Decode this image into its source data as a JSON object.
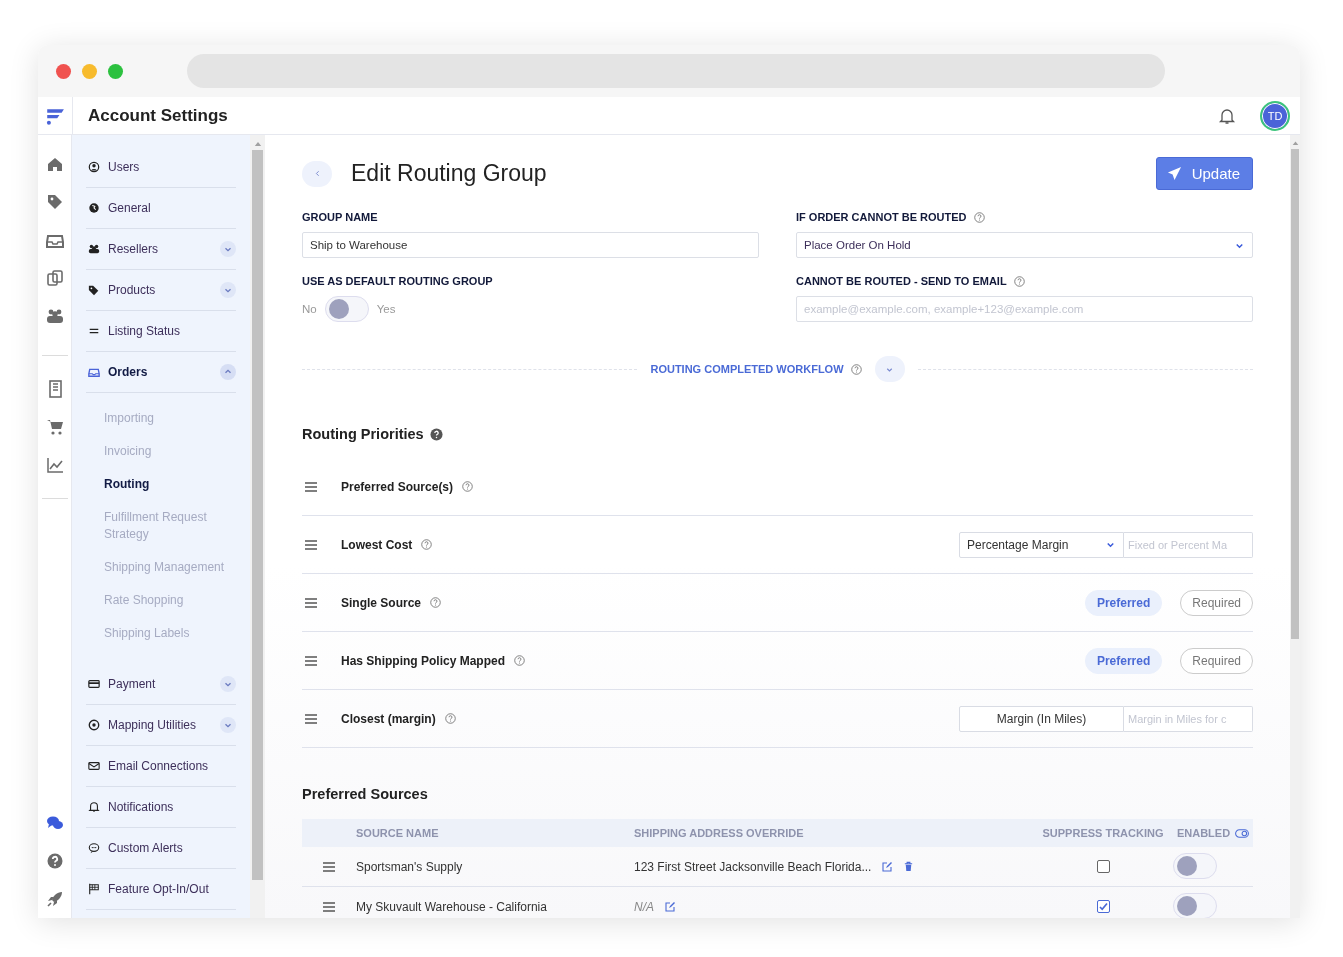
{
  "app": {
    "title": "Account Settings",
    "avatar": "TD"
  },
  "sidebar": {
    "items": [
      {
        "label": "Users",
        "expandable": false,
        "selected": false
      },
      {
        "label": "General",
        "expandable": false,
        "selected": false
      },
      {
        "label": "Resellers",
        "expandable": true,
        "expanded": false,
        "selected": false
      },
      {
        "label": "Products",
        "expandable": true,
        "expanded": false,
        "selected": false
      },
      {
        "label": "Listing Status",
        "expandable": false,
        "selected": false
      },
      {
        "label": "Orders",
        "expandable": true,
        "expanded": true,
        "selected": true,
        "children": [
          {
            "label": "Importing",
            "selected": false
          },
          {
            "label": "Invoicing",
            "selected": false
          },
          {
            "label": "Routing",
            "selected": true
          },
          {
            "label": "Fulfillment Request Strategy",
            "selected": false
          },
          {
            "label": "Shipping Management",
            "selected": false
          },
          {
            "label": "Rate Shopping",
            "selected": false
          },
          {
            "label": "Shipping Labels",
            "selected": false
          }
        ]
      },
      {
        "label": "Payment",
        "expandable": true,
        "expanded": false,
        "selected": false
      },
      {
        "label": "Mapping Utilities",
        "expandable": true,
        "expanded": false,
        "selected": false
      },
      {
        "label": "Email Connections",
        "expandable": false,
        "selected": false
      },
      {
        "label": "Notifications",
        "expandable": false,
        "selected": false
      },
      {
        "label": "Custom Alerts",
        "expandable": false,
        "selected": false
      },
      {
        "label": "Feature Opt-In/Out",
        "expandable": false,
        "selected": false
      }
    ]
  },
  "page": {
    "title": "Edit Routing Group",
    "update_button": "Update",
    "group_name": {
      "label": "GROUP NAME",
      "value": "Ship to Warehouse"
    },
    "cannot_route": {
      "label": "IF ORDER CANNOT BE ROUTED",
      "value": "Place Order On Hold"
    },
    "default_group": {
      "label": "USE AS DEFAULT ROUTING GROUP",
      "off_label": "No",
      "on_label": "Yes",
      "on": false
    },
    "send_email": {
      "label": "CANNOT BE ROUTED - SEND TO EMAIL",
      "placeholder": "example@example.com, example+123@example.com"
    },
    "workflow": {
      "label": "ROUTING COMPLETED WORKFLOW",
      "expanded": false
    }
  },
  "routing_priorities": {
    "title": "Routing Priorities",
    "rows": [
      {
        "kind": "plain",
        "label": "Preferred Source(s)"
      },
      {
        "kind": "select-input",
        "label": "Lowest Cost",
        "select": "Percentage Margin",
        "placeholder": "Fixed or Percent Ma"
      },
      {
        "kind": "choice",
        "label": "Single Source",
        "options": [
          {
            "label": "Preferred",
            "selected": true
          },
          {
            "label": "Required",
            "selected": false
          }
        ]
      },
      {
        "kind": "choice",
        "label": "Has Shipping Policy Mapped",
        "options": [
          {
            "label": "Preferred",
            "selected": true
          },
          {
            "label": "Required",
            "selected": false
          }
        ]
      },
      {
        "kind": "text-input",
        "label": "Closest (margin)",
        "value": "Margin (In Miles)",
        "placeholder": "Margin in Miles for c"
      }
    ]
  },
  "preferred_sources": {
    "title": "Preferred Sources",
    "columns": [
      "SOURCE NAME",
      "SHIPPING ADDRESS OVERRIDE",
      "SUPPRESS TRACKING",
      "ENABLED"
    ],
    "rows": [
      {
        "name": "Sportsman's Supply",
        "address": "123 First Street Jacksonville Beach Florida...",
        "address_set": true,
        "deletable": true,
        "suppress_tracking": false,
        "enabled": false
      },
      {
        "name": "My Skuvault Warehouse - California",
        "address": "N/A",
        "address_set": false,
        "deletable": false,
        "suppress_tracking": true,
        "enabled": false
      }
    ]
  }
}
